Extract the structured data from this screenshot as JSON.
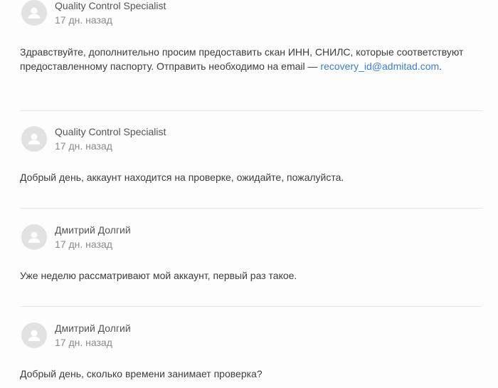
{
  "comments": [
    {
      "author": "Quality Control Specialist",
      "time": "17 дн. назад",
      "text_before_link": "Здравствуйте, дополнительно просим предоставить скан ИНН, СНИЛС, которые соответствуют предоставленному паспорту. Отправить необходимо на email — ",
      "link": "recovery_id@admitad.com",
      "text_after_link": "."
    },
    {
      "author": "Quality Control Specialist",
      "time": "17 дн. назад",
      "text": "Добрый день, аккаунт находится на проверке, ожидайте, пожалуйста."
    },
    {
      "author": "Дмитрий Долгий",
      "time": "17 дн. назад",
      "text": "Уже неделю рассматривают мой аккаунт, первый раз такое."
    },
    {
      "author": "Дмитрий Долгий",
      "time": "17 дн. назад",
      "text": "Добрый день, сколько времени занимает проверка?"
    }
  ],
  "colors": {
    "avatar_bg": "#e2e2e2",
    "avatar_fg": "#ffffff",
    "link": "#3f7fc8",
    "divider": "#e6e6e6"
  },
  "icons": {
    "avatar": "user-silhouette-icon"
  }
}
